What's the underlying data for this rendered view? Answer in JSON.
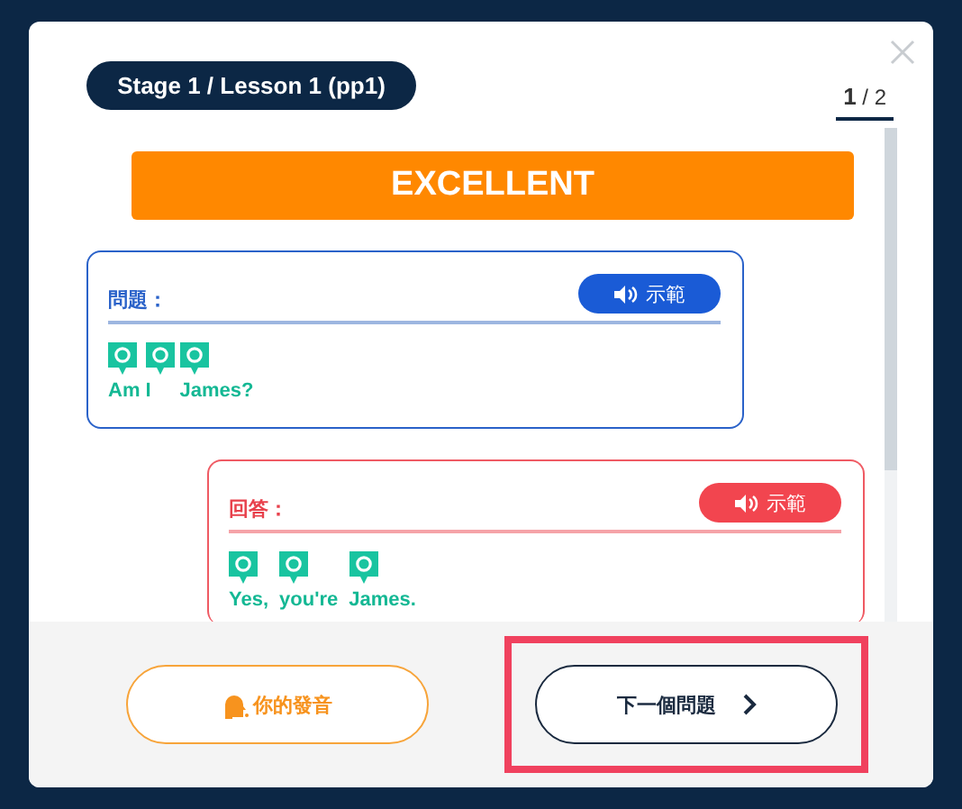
{
  "lesson_badge": "Stage 1 / Lesson 1 (pp1)",
  "page_counter": {
    "current": "1",
    "total": "/ 2"
  },
  "result_banner": "EXCELLENT",
  "cards": [
    {
      "kind": "question",
      "label": "問題：",
      "demo_button": "示範",
      "words": [
        "Am",
        "I",
        "James?"
      ]
    },
    {
      "kind": "answer",
      "label": "回答：",
      "demo_button": "示範",
      "words": [
        "Yes,",
        "you're",
        "James."
      ]
    }
  ],
  "footer": {
    "record_button": "你的發音",
    "next_button": {
      "label": "下一個問題",
      "highlighted": true
    }
  }
}
